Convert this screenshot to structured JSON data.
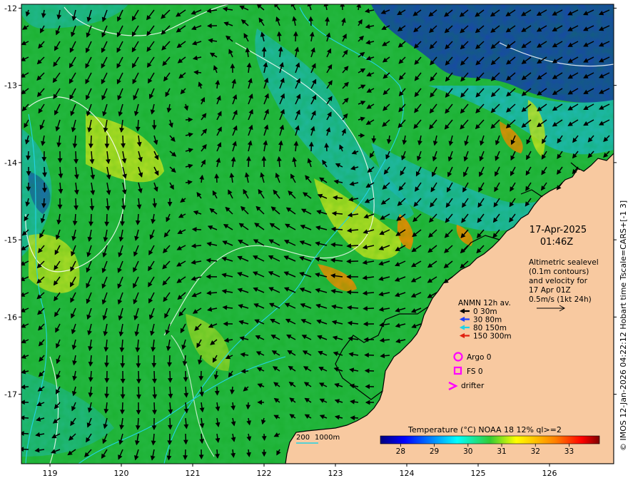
{
  "colors": {
    "land": "#f8c9a0",
    "coast": "#000000",
    "contour_white": "#ffffff",
    "contour_cyan": "#22d3e6",
    "sst_green": "#22bb44",
    "sst_blue": "#1840b0",
    "sst_cyan": "#20b8c8",
    "sst_yellow": "#d8e820",
    "sst_orange": "#ff8800",
    "legend_black": "#000000",
    "legend_blue": "#1e40ff",
    "legend_cyan": "#22d3e6",
    "legend_red": "#e02010",
    "marker_magenta": "#ff00ff"
  },
  "axes": {
    "x_ticks": [
      "119",
      "120",
      "121",
      "122",
      "123",
      "124",
      "125",
      "126"
    ],
    "y_ticks": [
      "-12",
      "-13",
      "-14",
      "-15",
      "-16",
      "-17"
    ],
    "lon_range": [
      118.6,
      126.9
    ],
    "lat_range": [
      -17.9,
      -11.95
    ]
  },
  "annotation": {
    "date": "17-Apr-2025",
    "time": "01:46Z",
    "altimetry_lines": [
      "Altimetric sealevel",
      "(0.1m contours)",
      "and velocity for",
      "17 Apr 01Z",
      "0.5m/s (1kt 24h)"
    ]
  },
  "anmn_legend": {
    "title": "ANMN 12h av.",
    "items": [
      {
        "label": "0 30m",
        "color_key": "legend_black"
      },
      {
        "label": "30 80m",
        "color_key": "legend_blue"
      },
      {
        "label": "80 150m",
        "color_key": "legend_cyan"
      },
      {
        "label": "150 300m",
        "color_key": "legend_red"
      }
    ]
  },
  "markers": {
    "argo": "Argo 0",
    "fs": "FS 0",
    "drifter": "drifter"
  },
  "isobath_legend": {
    "label_200": "200",
    "label_1000": "1000m"
  },
  "colorbar": {
    "title": "Temperature (°C) NOAA 18 12% ql>=2",
    "ticks": [
      "28",
      "29",
      "30",
      "31",
      "32",
      "33"
    ],
    "tick_values": [
      28,
      29,
      30,
      31,
      32,
      33
    ],
    "range": [
      27.4,
      33.9
    ]
  },
  "credit": "© IMOS 12-Jan-2026 04:22:12 Hobart time Tscale=CARS+[-1 3]"
}
